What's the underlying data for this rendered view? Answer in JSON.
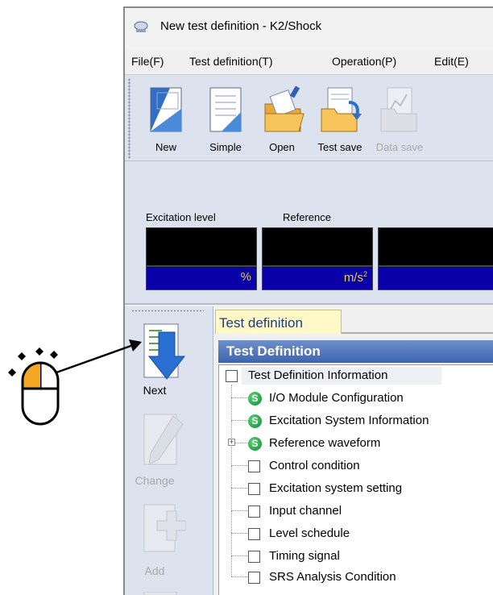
{
  "window": {
    "title": "New test definition - K2/Shock"
  },
  "menu": {
    "items": [
      "File(F)",
      "Test definition(T)",
      "Operation(P)",
      "Edit(E)"
    ]
  },
  "toolbar": {
    "buttons": [
      {
        "label": "New",
        "icon": "new-document-icon",
        "enabled": true
      },
      {
        "label": "Simple",
        "icon": "simple-document-icon",
        "enabled": true
      },
      {
        "label": "Open",
        "icon": "open-folder-icon",
        "enabled": true
      },
      {
        "label": "Test save",
        "icon": "save-folder-icon",
        "enabled": true
      },
      {
        "label": "Data save",
        "icon": "data-save-icon",
        "enabled": false
      }
    ]
  },
  "meters": {
    "excitation_caption": "Excitation level",
    "reference_caption": "Reference",
    "excitation_unit": "%",
    "reference_unit": "m/s",
    "reference_unit_sup": "2"
  },
  "sidebar": {
    "buttons": [
      {
        "label": "Next",
        "icon": "next-arrow-icon",
        "enabled": true
      },
      {
        "label": "Change",
        "icon": "pencil-icon",
        "enabled": false
      },
      {
        "label": "Add",
        "icon": "add-plus-icon",
        "enabled": false
      }
    ]
  },
  "definition": {
    "tab_label": "Test definition",
    "header": "Test Definition",
    "tree": [
      {
        "label": "Test Definition Information",
        "marker": "checkbox",
        "level": 0
      },
      {
        "label": "I/O Module Configuration",
        "marker": "S",
        "level": 1
      },
      {
        "label": "Excitation System Information",
        "marker": "S",
        "level": 1
      },
      {
        "label": "Reference waveform",
        "marker": "S",
        "level": 1,
        "expander": "+"
      },
      {
        "label": "Control condition",
        "marker": "checkbox",
        "level": 1
      },
      {
        "label": "Excitation system setting",
        "marker": "checkbox",
        "level": 1
      },
      {
        "label": "Input channel",
        "marker": "checkbox",
        "level": 1
      },
      {
        "label": "Level schedule",
        "marker": "checkbox",
        "level": 1
      },
      {
        "label": "Timing signal",
        "marker": "checkbox",
        "level": 1
      },
      {
        "label": "SRS Analysis Condition",
        "marker": "checkbox",
        "level": 1
      }
    ]
  },
  "colors": {
    "toolbar_bg": "#dde3ee",
    "header_blue": "#3c64b0",
    "meter_unit_bg": "#0a00a8",
    "meter_unit_text": "#f0d230",
    "badge_green": "#118a33",
    "mouse_button_orange": "#f5a623"
  }
}
